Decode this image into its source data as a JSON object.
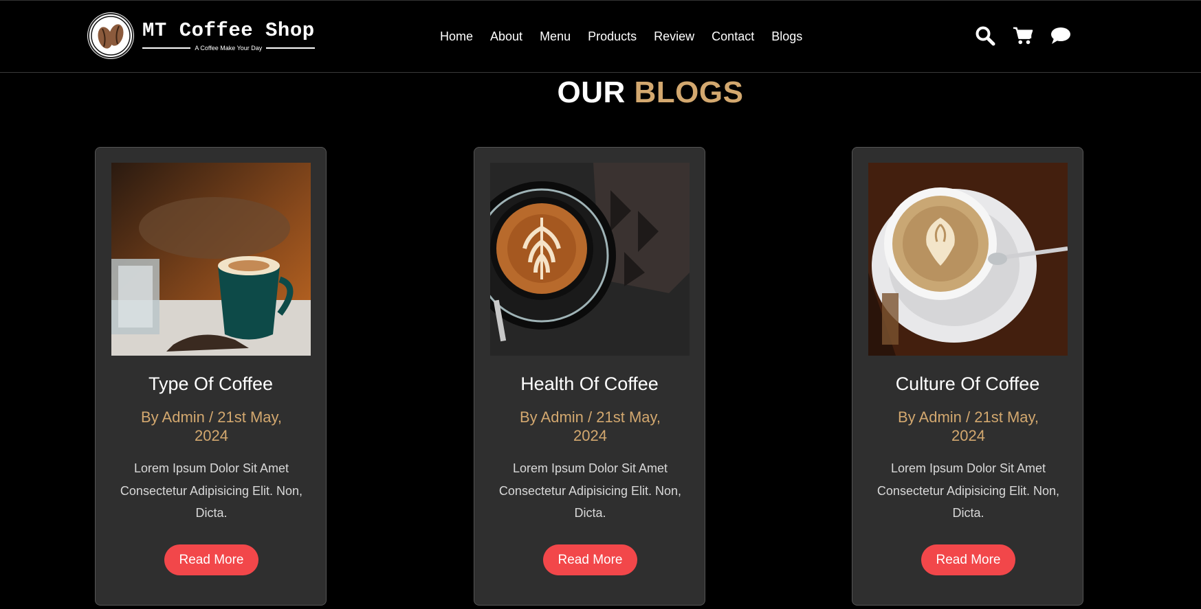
{
  "brand": {
    "title": "MT Coffee Shop",
    "tagline": "A Coffee Make Your Day"
  },
  "nav": {
    "items": [
      "Home",
      "About",
      "Menu",
      "Products",
      "Review",
      "Contact",
      "Blogs"
    ]
  },
  "header_icons": [
    "search-icon",
    "cart-icon",
    "chat-icon"
  ],
  "section": {
    "title_plain": "OUR",
    "title_accent": "BLOGS"
  },
  "blogs": [
    {
      "title": "Type Of Coffee",
      "meta": "By Admin / 21st May, 2024",
      "description": "Lorem Ipsum Dolor Sit Amet Consectetur Adipisicing Elit. Non, Dicta.",
      "button": "Read More"
    },
    {
      "title": "Health Of Coffee",
      "meta": "By Admin / 21st May, 2024",
      "description": "Lorem Ipsum Dolor Sit Amet Consectetur Adipisicing Elit. Non, Dicta.",
      "button": "Read More"
    },
    {
      "title": "Culture Of Coffee",
      "meta": "By Admin / 21st May, 2024",
      "description": "Lorem Ipsum Dolor Sit Amet Consectetur Adipisicing Elit. Non, Dicta.",
      "button": "Read More"
    }
  ],
  "colors": {
    "accent": "#d3a86f",
    "button": "#f2474a",
    "card_bg": "#2f2f2f",
    "page_bg": "#000000"
  }
}
